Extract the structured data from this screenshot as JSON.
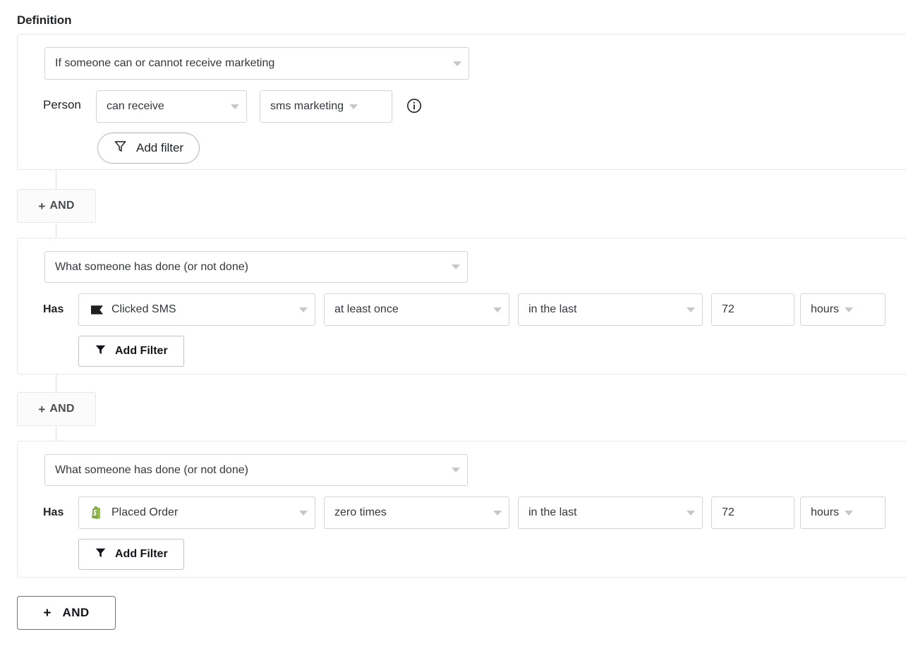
{
  "section": {
    "title": "Definition"
  },
  "groups": [
    {
      "type_select": {
        "value": "If someone can or cannot receive marketing",
        "icon": "chevron-down-icon"
      },
      "row_label": "Person",
      "fields": [
        {
          "name": "consent-state-select",
          "value": "can receive"
        },
        {
          "name": "channel-select",
          "value": "sms marketing"
        }
      ],
      "info_icon": "info-circle-icon",
      "add_filter": {
        "label": "Add filter",
        "icon": "funnel-outline-icon"
      }
    },
    {
      "type_select": {
        "value": "What someone has done (or not done)",
        "icon": "chevron-down-icon"
      },
      "row_label": "Has",
      "metric": {
        "name": "metric-select",
        "value": "Clicked SMS",
        "icon": "klaviyo-sms-flag-icon"
      },
      "frequency": {
        "name": "frequency-select",
        "value": "at least once"
      },
      "timeframe": {
        "name": "timeframe-select",
        "value": "in the last"
      },
      "amount": {
        "name": "timeframe-amount-input",
        "value": "72"
      },
      "unit": {
        "name": "timeframe-unit-select",
        "value": "hours"
      },
      "add_filter": {
        "label": "Add Filter",
        "icon": "funnel-filled-icon"
      }
    },
    {
      "type_select": {
        "value": "What someone has done (or not done)",
        "icon": "chevron-down-icon"
      },
      "row_label": "Has",
      "metric": {
        "name": "metric-select",
        "value": "Placed Order",
        "icon": "shopify-bag-icon"
      },
      "frequency": {
        "name": "frequency-select",
        "value": "zero times"
      },
      "timeframe": {
        "name": "timeframe-select",
        "value": "in the last"
      },
      "amount": {
        "name": "timeframe-amount-input",
        "value": "72"
      },
      "unit": {
        "name": "timeframe-unit-select",
        "value": "hours"
      },
      "add_filter": {
        "label": "Add Filter",
        "icon": "funnel-filled-icon"
      }
    }
  ],
  "and_chips": [
    {
      "plus": "+",
      "label": "AND"
    },
    {
      "plus": "+",
      "label": "AND"
    }
  ],
  "and_button": {
    "plus": "+",
    "label": "AND"
  },
  "colors": {
    "card_border": "#e6e8ea",
    "field_border": "#d2d5d8",
    "text": "#1f2326",
    "caret": "#c4c8cb",
    "shopify_green": "#95bf47",
    "sms_icon": "#1f1f1f"
  }
}
